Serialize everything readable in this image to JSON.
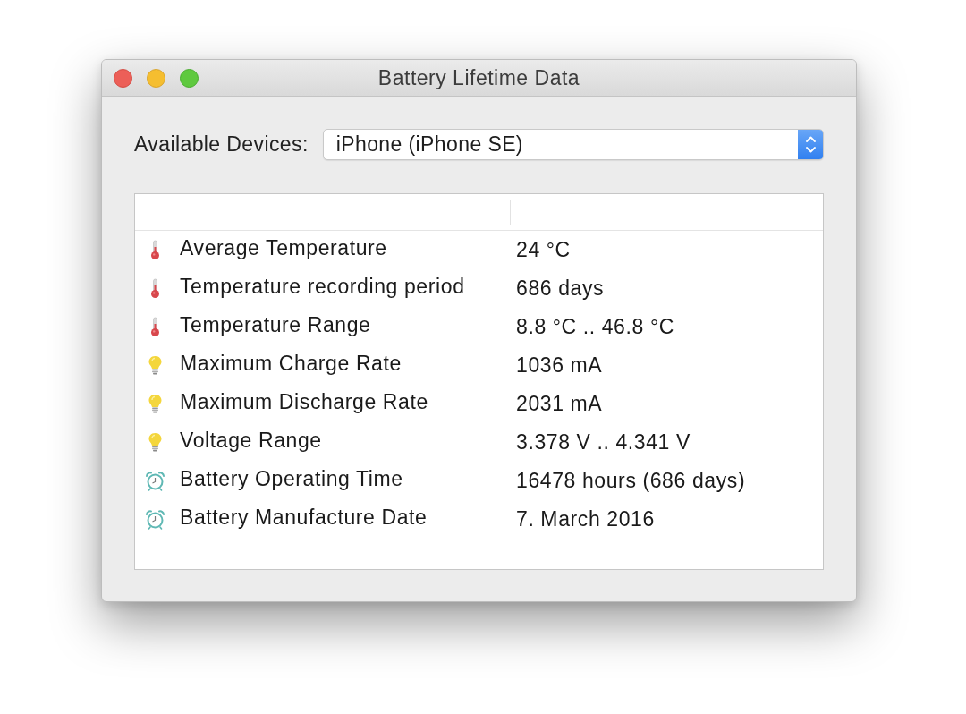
{
  "window": {
    "title": "Battery Lifetime Data"
  },
  "device_selector": {
    "label": "Available Devices:",
    "value": "iPhone (iPhone SE)"
  },
  "table": {
    "rows": [
      {
        "kind": "temperature",
        "name": "Average Temperature",
        "value": "24 °C"
      },
      {
        "kind": "temperature",
        "name": "Temperature recording period",
        "value": "686 days"
      },
      {
        "kind": "temperature",
        "name": "Temperature Range",
        "value": "8.8 °C .. 46.8 °C"
      },
      {
        "kind": "power",
        "name": "Maximum Charge Rate",
        "value": "1036 mA"
      },
      {
        "kind": "power",
        "name": "Maximum Discharge Rate",
        "value": "2031 mA"
      },
      {
        "kind": "power",
        "name": "Voltage Range",
        "value": "3.378 V .. 4.341 V"
      },
      {
        "kind": "time",
        "name": "Battery Operating Time",
        "value": "16478 hours (686 days)"
      },
      {
        "kind": "time",
        "name": "Battery Manufacture Date",
        "value": "7. March 2016"
      }
    ]
  }
}
